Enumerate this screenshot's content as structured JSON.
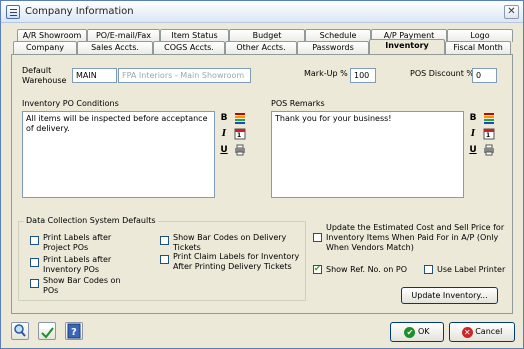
{
  "window": {
    "title": "Company Information",
    "close_glyph": "✕"
  },
  "tabs_row1": [
    "A/R Showroom",
    "PO/E-mail/Fax",
    "Item Status",
    "Budget",
    "Schedule",
    "A/P Payment",
    "Logo"
  ],
  "tabs_row2": [
    "Company",
    "Sales Accts.",
    "COGS Accts.",
    "Other Accts.",
    "Passwords",
    "Inventory",
    "Fiscal Month"
  ],
  "active_tab": "Inventory",
  "fields": {
    "default_warehouse_label": "Default Warehouse",
    "warehouse_code": "MAIN",
    "warehouse_name": "FPA Interiors - Main Showroom",
    "markup_label": "Mark-Up %",
    "markup_value": "100",
    "pos_discount_label": "POS Discount %",
    "pos_discount_value": "0"
  },
  "inventory_po": {
    "label": "Inventory PO Conditions",
    "text": "All items will be inspected before acceptance of delivery."
  },
  "pos_remarks": {
    "label": "POS Remarks",
    "text": "Thank you for your business!"
  },
  "toolbar_icons": [
    "bold-icon",
    "color-icon",
    "italic-icon",
    "calendar-icon",
    "underline-icon",
    "print-icon"
  ],
  "toolbar_glyphs": {
    "bold": "B",
    "italic": "I",
    "underline": "U",
    "calendar_day": "1"
  },
  "data_collection": {
    "title": "Data Collection System Defaults",
    "options": [
      {
        "label": "Print Labels after Project POs",
        "checked": false
      },
      {
        "label": "Print Labels after Inventory POs",
        "checked": false
      },
      {
        "label": "Show Bar Codes on POs",
        "checked": false
      },
      {
        "label": "Show Bar Codes on Delivery Tickets",
        "checked": false
      },
      {
        "label": "Print Claim Labels for Inventory After Printing Delivery Tickets",
        "checked": false
      }
    ]
  },
  "right_options": {
    "update_cost": {
      "label": "Update the Estimated Cost and Sell Price for Inventory Items When Paid For in A/P (Only When Vendors Match)",
      "checked": false
    },
    "show_ref": {
      "label": "Show Ref. No. on PO",
      "checked": true
    },
    "use_label_printer": {
      "label": "Use Label Printer",
      "checked": false
    }
  },
  "buttons": {
    "update_inventory": "Update Inventory...",
    "ok": "OK",
    "cancel": "Cancel"
  },
  "colors": {
    "window_bg": "#ECE9D8",
    "border": "#919b9c",
    "ok_green": "#1e8f2a",
    "cancel_red": "#c82828"
  }
}
